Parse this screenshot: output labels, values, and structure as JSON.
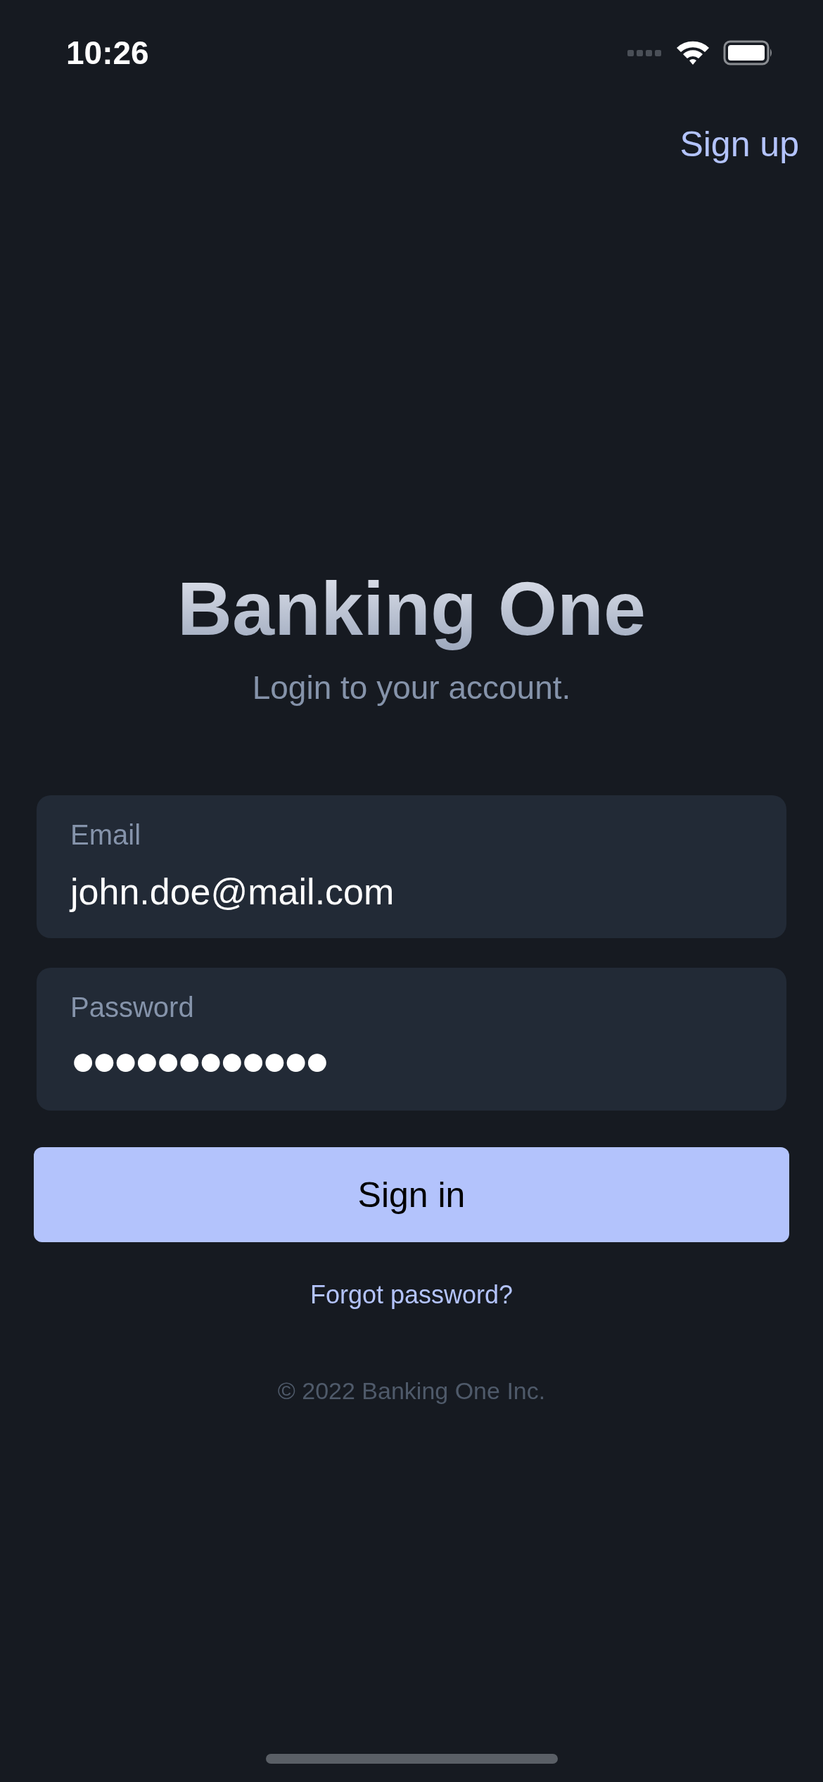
{
  "status_bar": {
    "time": "10:26"
  },
  "header": {
    "sign_up": "Sign up"
  },
  "title": "Banking One",
  "subtitle": "Login to your account.",
  "fields": [
    {
      "label": "Email",
      "value": "john.doe@mail.com",
      "kind": "text"
    },
    {
      "label": "Password",
      "value": "●●●●●●●●●●●●",
      "kind": "password"
    }
  ],
  "sign_in_button": "Sign in",
  "forgot_password": "Forgot password?",
  "footer": "© 2022 Banking One Inc."
}
